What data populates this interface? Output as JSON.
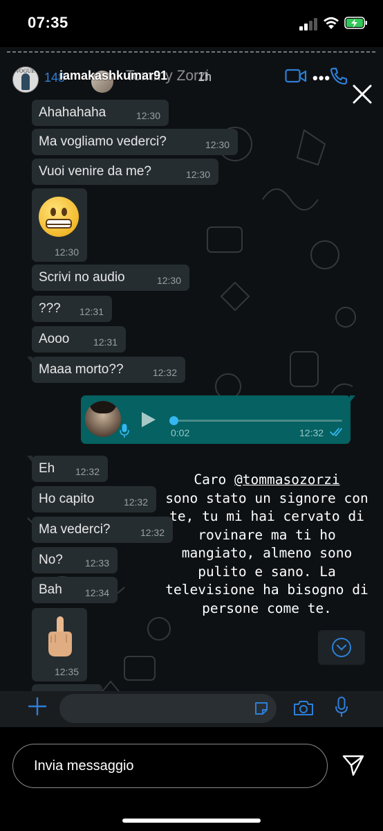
{
  "status_bar": {
    "time": "07:35"
  },
  "story": {
    "username": "iamakashkumar91",
    "age": "1h",
    "screenshot_header": {
      "unread_count": "148",
      "contact_name": "Tommy Zorzi"
    },
    "messages": [
      {
        "text": "Ahahahaha",
        "time": "12:30"
      },
      {
        "text": "Ma vogliamo vederci?",
        "time": "12:30"
      },
      {
        "text": "Vuoi venire da me?",
        "time": "12:30"
      },
      {
        "emoji": "grimacing-face",
        "time": "12:30"
      },
      {
        "text": "Scrivi no audio",
        "time": "12:30"
      },
      {
        "text": "???",
        "time": "12:31"
      },
      {
        "text": "Aooo",
        "time": "12:31"
      },
      {
        "text": "Maaa morto??",
        "time": "12:32"
      },
      {
        "text": "Eh",
        "time": "12:32"
      },
      {
        "text": "Ho capito",
        "time": "12:32"
      },
      {
        "text": "Ma vederci?",
        "time": "12:32"
      },
      {
        "text": "No?",
        "time": "12:33"
      },
      {
        "text": "Bah",
        "time": "12:34"
      },
      {
        "emoji": "middle-finger",
        "time": "12:35"
      }
    ],
    "voice_message": {
      "duration": "0:02",
      "time": "12:32",
      "progress": 0.0,
      "status": "read"
    },
    "caption": {
      "line1_prefix": "Caro ",
      "mention": "@tommasozorzi",
      "rest": "sono stato un signore con te, tu mi hai cervato di rovinare ma ti ho mangiato, almeno sono pulito e sano. La televisione ha bisogno di persone come te."
    }
  },
  "reply": {
    "placeholder": "Invia messaggio"
  },
  "colors": {
    "bubble": "#262d31",
    "outgoing": "#056162",
    "accent": "#34b7f1",
    "wa_blue": "#2e7fd8"
  }
}
